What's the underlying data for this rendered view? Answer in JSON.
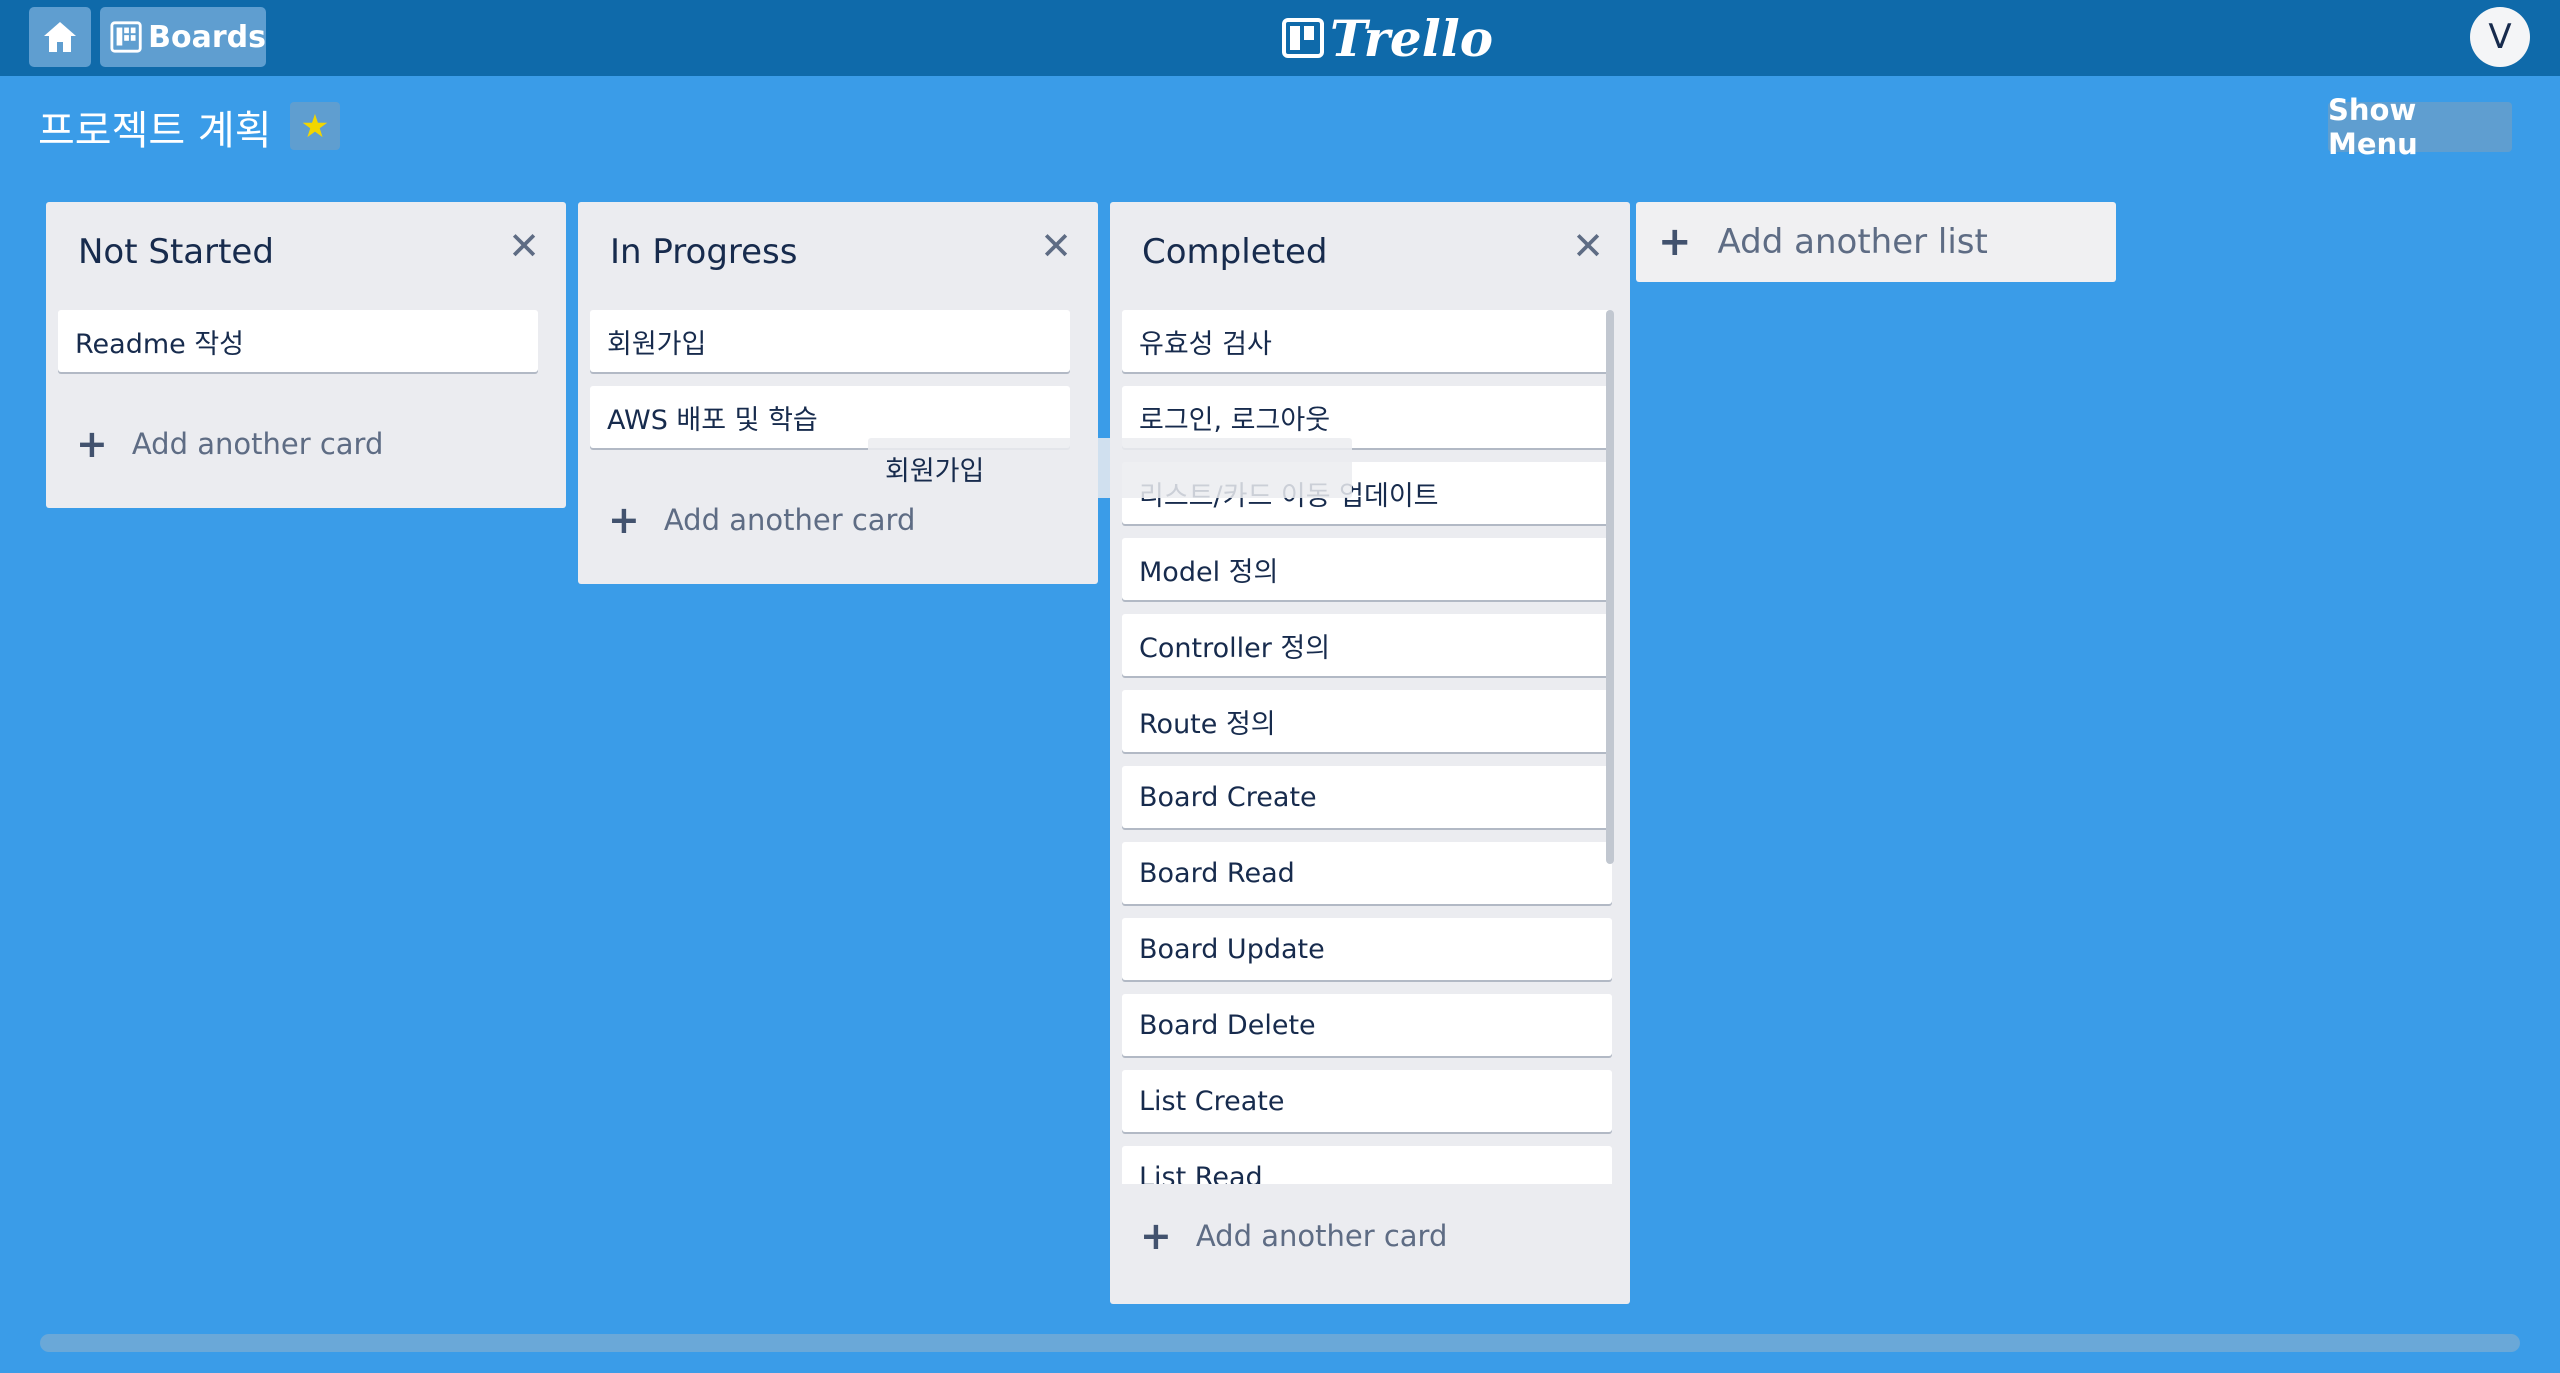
{
  "topbar": {
    "boards_label": "Boards",
    "logo_text": "Trello",
    "avatar_initial": "V"
  },
  "board": {
    "title": "프로젝트 계획",
    "starred": true,
    "star_color": "#f2d600",
    "show_menu_label": "Show Menu"
  },
  "lists": [
    {
      "title": "Not Started",
      "cards": [
        "Readme 작성"
      ],
      "add_card_label": "Add another card"
    },
    {
      "title": "In Progress",
      "cards": [
        "회원가입",
        "AWS 배포 및 학습"
      ],
      "add_card_label": "Add another card"
    },
    {
      "title": "Completed",
      "cards": [
        "유효성 검사",
        "로그인, 로그아웃",
        "리스트/카드 이동 업데이트",
        "Model 정의",
        "Controller 정의",
        "Route 정의",
        "Board Create",
        "Board Read",
        "Board Update",
        "Board Delete",
        "List Create",
        "List Read"
      ],
      "add_card_label": "Add another card"
    }
  ],
  "add_list_label": "Add another list",
  "dragging_card": "회원가입",
  "colors": {
    "background": "#3a9ce8",
    "topbar": "#0f6aaa",
    "list_bg": "#ebecf0"
  }
}
